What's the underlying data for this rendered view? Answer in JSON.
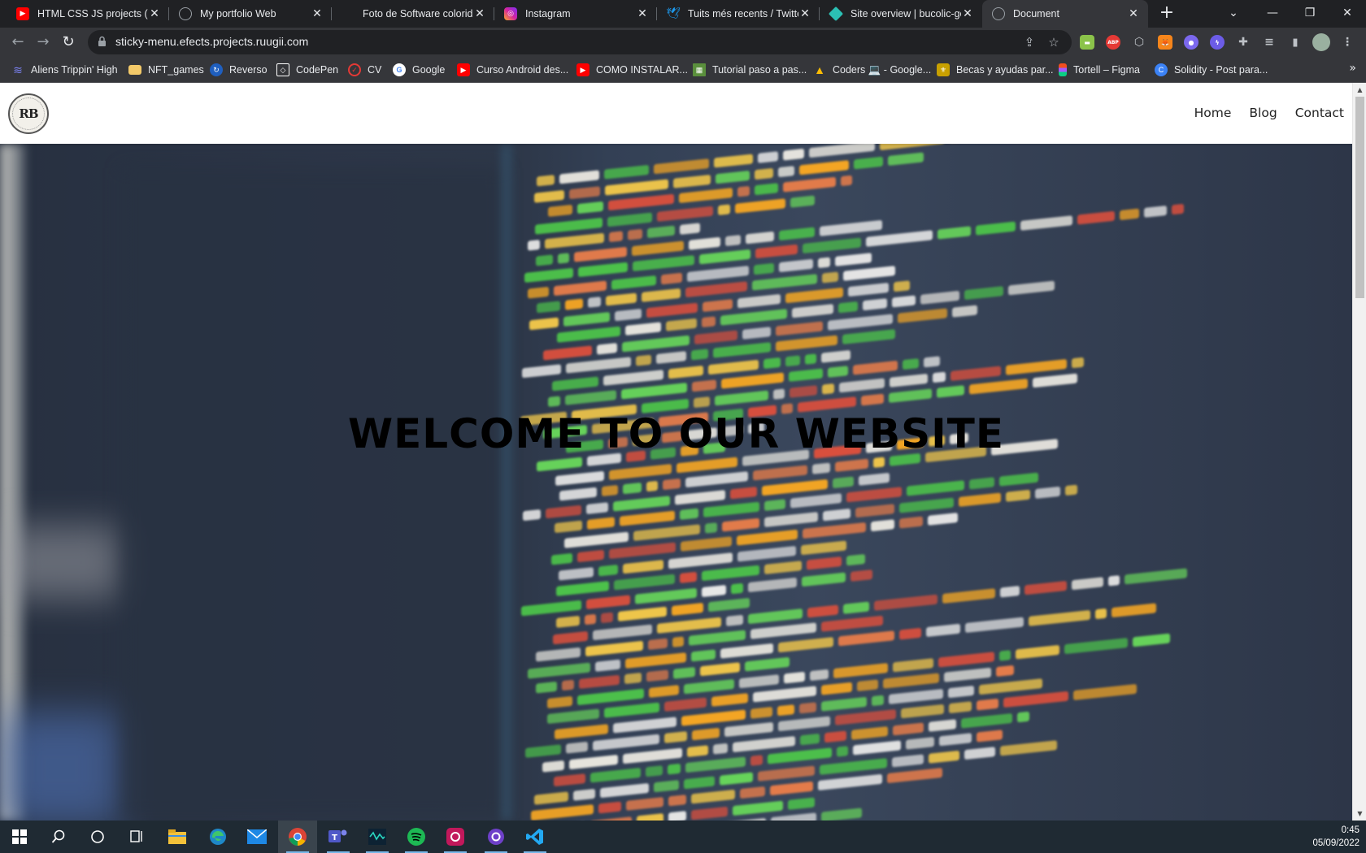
{
  "tabs": [
    {
      "title": "HTML CSS JS projects (Be",
      "icon": "youtube-icon",
      "color": "#ff0000",
      "active": false
    },
    {
      "title": "My portfolio Web",
      "icon": "globe-icon",
      "color": "#9aa0a6",
      "active": false
    },
    {
      "title": "Foto de Software colorido",
      "icon": "",
      "color": "",
      "active": false
    },
    {
      "title": "Instagram",
      "icon": "instagram-icon",
      "color": "#d6249f",
      "active": false
    },
    {
      "title": "Tuits més recents / Twitte",
      "icon": "twitter-icon",
      "color": "#1d9bf0",
      "active": false
    },
    {
      "title": "Site overview | bucolic-ge",
      "icon": "netlify-icon",
      "color": "#2bc0b4",
      "active": false
    },
    {
      "title": "Document",
      "icon": "globe-icon",
      "color": "#9aa0a6",
      "active": true
    }
  ],
  "toolbar": {
    "url": "sticky-menu.efects.projects.ruugii.com"
  },
  "bookmarks": [
    {
      "label": "Aliens Trippin' High",
      "icon": "stack-icon",
      "color": "#6a5acd"
    },
    {
      "label": "NFT_games",
      "icon": "folder-icon",
      "color": "#f3c969"
    },
    {
      "label": "Reverso",
      "icon": "reverso-icon",
      "color": "#1f5fbf"
    },
    {
      "label": "CodePen",
      "icon": "codepen-icon",
      "color": "#ffffff"
    },
    {
      "label": "CV",
      "icon": "check-circle-icon",
      "color": "#e53935"
    },
    {
      "label": "Google",
      "icon": "google-icon",
      "color": "#ffffff"
    },
    {
      "label": "Curso Android des...",
      "icon": "youtube-icon",
      "color": "#ff0000"
    },
    {
      "label": "COMO INSTALAR...",
      "icon": "youtube-icon",
      "color": "#ff0000"
    },
    {
      "label": "Tutorial paso a pas...",
      "icon": "minecraft-icon",
      "color": "#5a8f3c"
    },
    {
      "label": "Coders 💻 - Google...",
      "icon": "drive-icon",
      "color": "#fbbc04"
    },
    {
      "label": "Becas y ayudas par...",
      "icon": "crest-icon",
      "color": "#c8a000"
    },
    {
      "label": "Tortell – Figma",
      "icon": "figma-icon",
      "color": "#f24e1e"
    },
    {
      "label": "Solidity - Post para...",
      "icon": "c-icon",
      "color": "#3b82f6"
    }
  ],
  "site": {
    "logo_text": "RB",
    "nav": [
      "Home",
      "Blog",
      "Contact"
    ],
    "headline": "WELCOME TO OUR WEBSITE"
  },
  "taskbar": {
    "time": "0:45",
    "date": "05/09/2022"
  },
  "colors": {
    "code_palette": [
      "#e8e6df",
      "#f0c64a",
      "#e37b4a",
      "#4cc24a",
      "#e6e6e6",
      "#f5a623",
      "#66d35a",
      "#d94f3d"
    ]
  }
}
